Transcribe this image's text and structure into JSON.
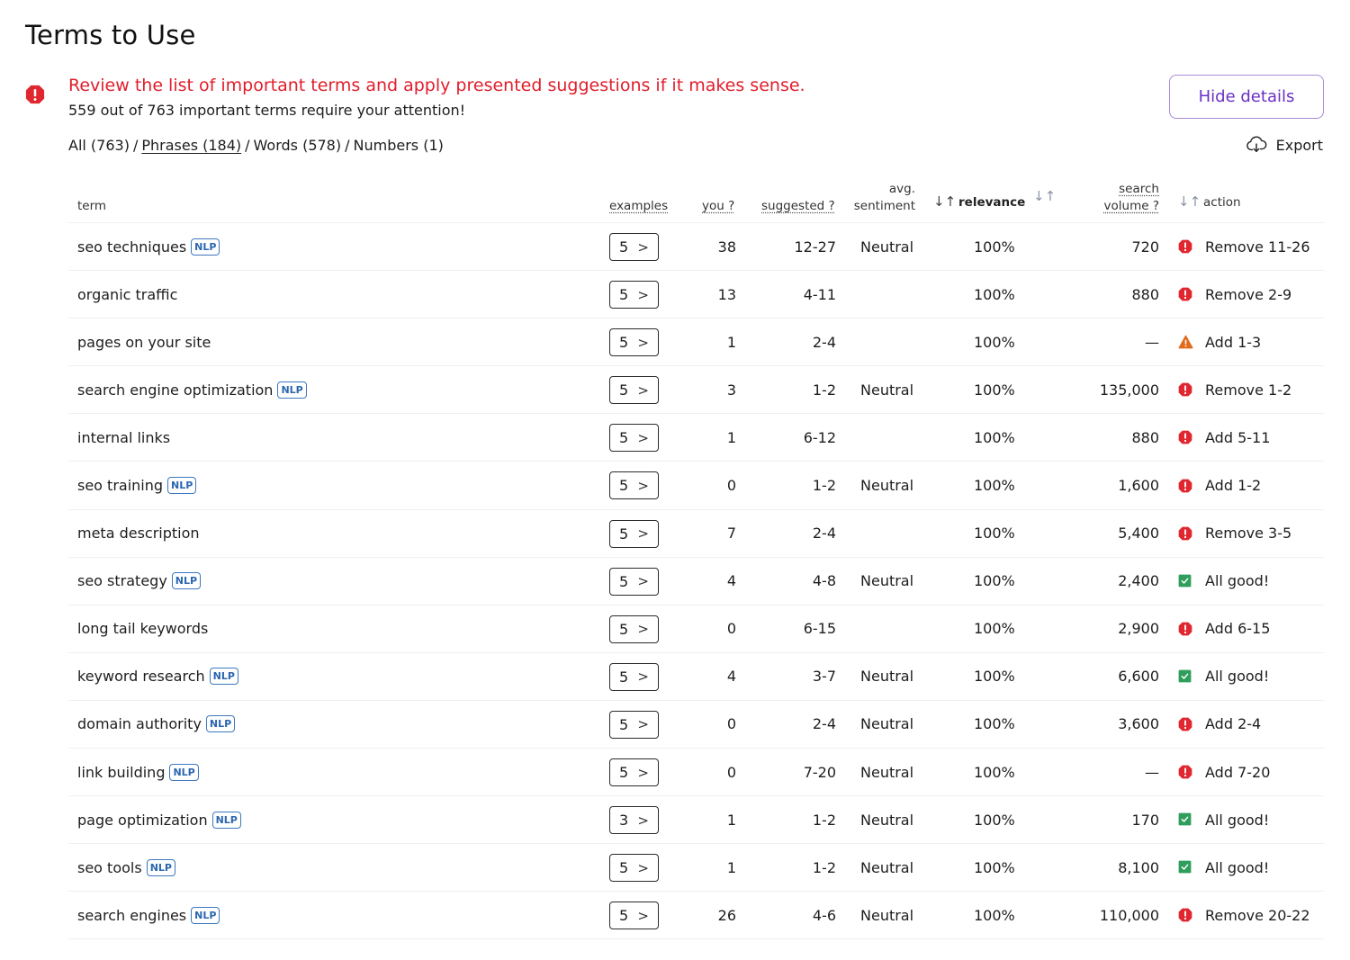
{
  "page": {
    "title": "Terms to Use"
  },
  "alert": {
    "title": "Review the list of important terms and apply presented suggestions if it makes sense.",
    "subtitle": "559 out of 763 important terms require your attention!",
    "icon": "error-octagon-icon",
    "color": "#e01e2b"
  },
  "hide_details_label": "Hide details",
  "export_label": "Export",
  "filters": [
    {
      "label": "All (763)",
      "active": false
    },
    {
      "label": "Phrases (184)",
      "active": true
    },
    {
      "label": "Words (578)",
      "active": false
    },
    {
      "label": "Numbers (1)",
      "active": false
    }
  ],
  "columns": {
    "term": "term",
    "examples": "examples",
    "you": "you ?",
    "suggested": "suggested ?",
    "sentiment_line1": "avg.",
    "sentiment_line2": "sentiment",
    "relevance": "relevance",
    "volume_line1": "search",
    "volume_line2": "volume ?",
    "action": "action",
    "sort_icon": "↓↑"
  },
  "nlp_badge": "NLP",
  "colors": {
    "error": "#e0262f",
    "warning": "#e06b1c",
    "ok": "#2e9e5b",
    "nlp": "#2b66b0",
    "accent": "#6a2fc4"
  },
  "rows": [
    {
      "term": "seo techniques",
      "nlp": true,
      "examples": "5",
      "you": "38",
      "suggested": "12-27",
      "sentiment": "Neutral",
      "relevance": "100%",
      "volume": "720",
      "status": "error",
      "action": "Remove 11-26"
    },
    {
      "term": "organic traffic",
      "nlp": false,
      "examples": "5",
      "you": "13",
      "suggested": "4-11",
      "sentiment": "",
      "relevance": "100%",
      "volume": "880",
      "status": "error",
      "action": "Remove 2-9"
    },
    {
      "term": "pages on your site",
      "nlp": false,
      "examples": "5",
      "you": "1",
      "suggested": "2-4",
      "sentiment": "",
      "relevance": "100%",
      "volume": "—",
      "status": "warning",
      "action": "Add 1-3"
    },
    {
      "term": "search engine optimization",
      "nlp": true,
      "examples": "5",
      "you": "3",
      "suggested": "1-2",
      "sentiment": "Neutral",
      "relevance": "100%",
      "volume": "135,000",
      "status": "error",
      "action": "Remove 1-2"
    },
    {
      "term": "internal links",
      "nlp": false,
      "examples": "5",
      "you": "1",
      "suggested": "6-12",
      "sentiment": "",
      "relevance": "100%",
      "volume": "880",
      "status": "error",
      "action": "Add 5-11"
    },
    {
      "term": "seo training",
      "nlp": true,
      "examples": "5",
      "you": "0",
      "suggested": "1-2",
      "sentiment": "Neutral",
      "relevance": "100%",
      "volume": "1,600",
      "status": "error",
      "action": "Add 1-2"
    },
    {
      "term": "meta description",
      "nlp": false,
      "examples": "5",
      "you": "7",
      "suggested": "2-4",
      "sentiment": "",
      "relevance": "100%",
      "volume": "5,400",
      "status": "error",
      "action": "Remove 3-5"
    },
    {
      "term": "seo strategy",
      "nlp": true,
      "examples": "5",
      "you": "4",
      "suggested": "4-8",
      "sentiment": "Neutral",
      "relevance": "100%",
      "volume": "2,400",
      "status": "ok",
      "action": "All good!"
    },
    {
      "term": "long tail keywords",
      "nlp": false,
      "examples": "5",
      "you": "0",
      "suggested": "6-15",
      "sentiment": "",
      "relevance": "100%",
      "volume": "2,900",
      "status": "error",
      "action": "Add 6-15"
    },
    {
      "term": "keyword research",
      "nlp": true,
      "examples": "5",
      "you": "4",
      "suggested": "3-7",
      "sentiment": "Neutral",
      "relevance": "100%",
      "volume": "6,600",
      "status": "ok",
      "action": "All good!"
    },
    {
      "term": "domain authority",
      "nlp": true,
      "examples": "5",
      "you": "0",
      "suggested": "2-4",
      "sentiment": "Neutral",
      "relevance": "100%",
      "volume": "3,600",
      "status": "error",
      "action": "Add 2-4"
    },
    {
      "term": "link building",
      "nlp": true,
      "examples": "5",
      "you": "0",
      "suggested": "7-20",
      "sentiment": "Neutral",
      "relevance": "100%",
      "volume": "—",
      "status": "error",
      "action": "Add 7-20"
    },
    {
      "term": "page optimization",
      "nlp": true,
      "examples": "3",
      "you": "1",
      "suggested": "1-2",
      "sentiment": "Neutral",
      "relevance": "100%",
      "volume": "170",
      "status": "ok",
      "action": "All good!"
    },
    {
      "term": "seo tools",
      "nlp": true,
      "examples": "5",
      "you": "1",
      "suggested": "1-2",
      "sentiment": "Neutral",
      "relevance": "100%",
      "volume": "8,100",
      "status": "ok",
      "action": "All good!"
    },
    {
      "term": "search engines",
      "nlp": true,
      "examples": "5",
      "you": "26",
      "suggested": "4-6",
      "sentiment": "Neutral",
      "relevance": "100%",
      "volume": "110,000",
      "status": "error",
      "action": "Remove 20-22"
    }
  ]
}
